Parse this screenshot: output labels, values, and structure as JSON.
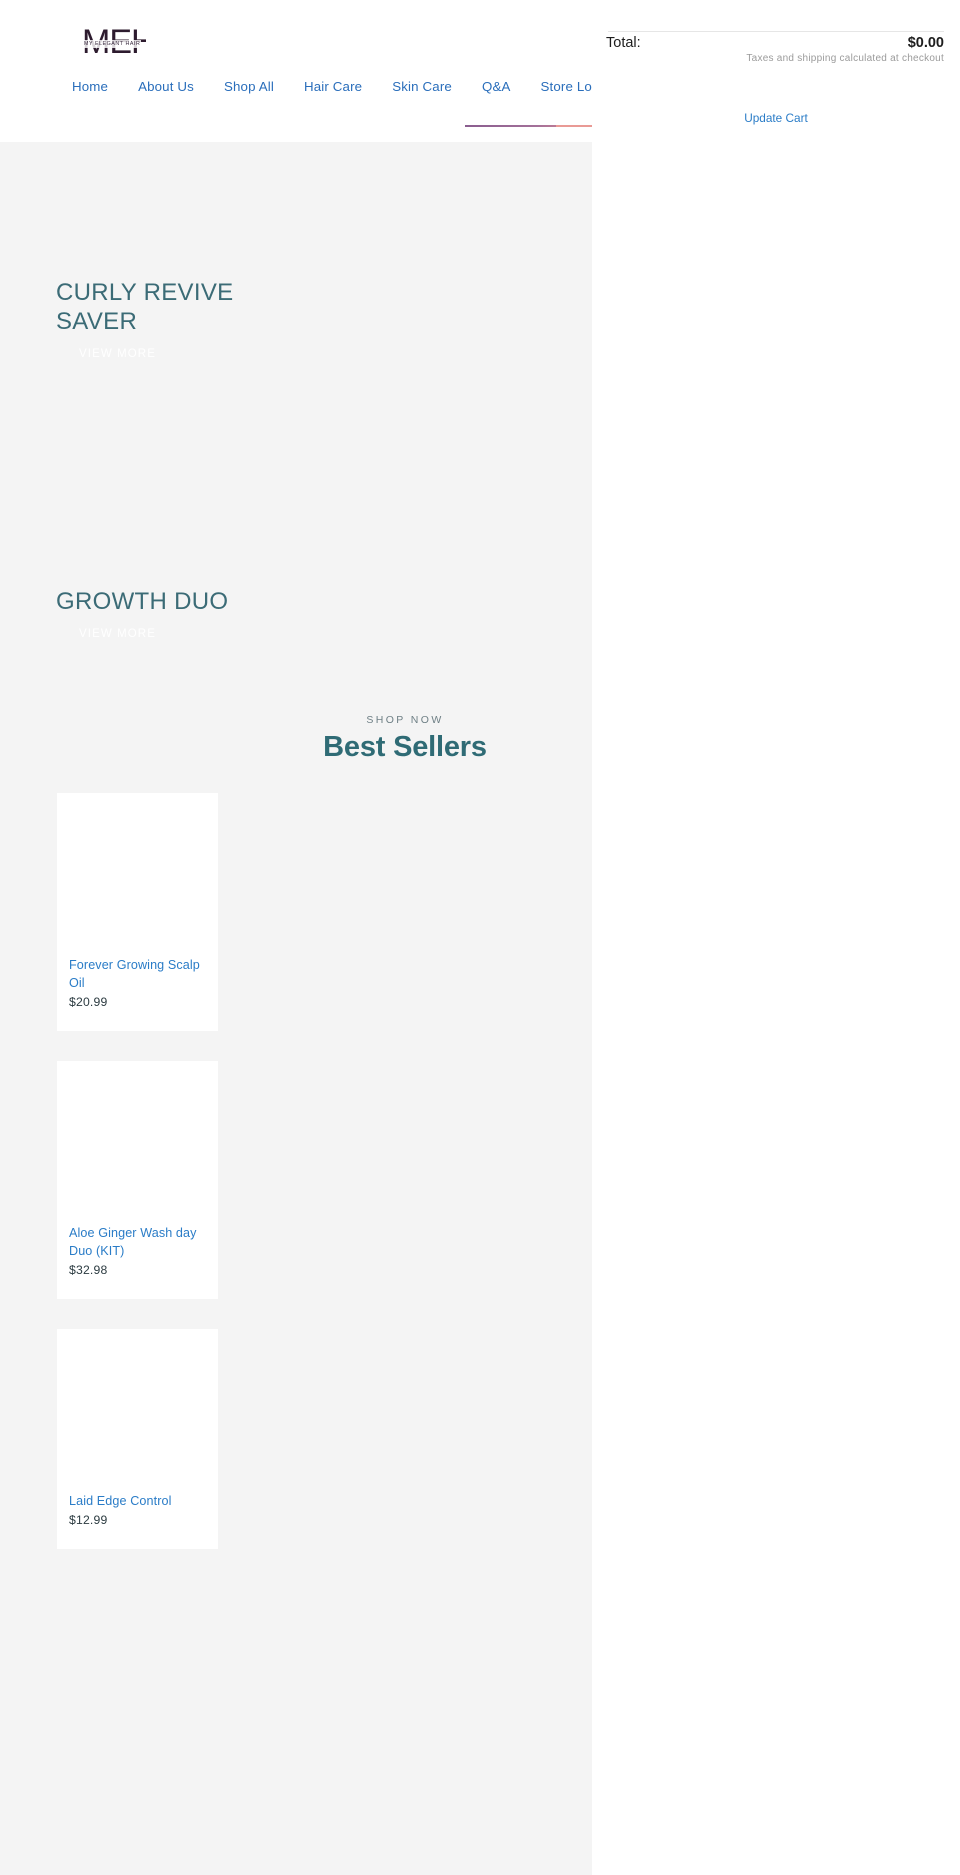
{
  "site": {
    "logo_mark": "MEH",
    "logo_tagline": "MY ELEGANT HAIR"
  },
  "nav": {
    "items": [
      {
        "label": "Home"
      },
      {
        "label": "About Us"
      },
      {
        "label": "Shop All"
      },
      {
        "label": "Hair Care"
      },
      {
        "label": "Skin Care"
      },
      {
        "label": "Q&A"
      },
      {
        "label": "Store Location"
      }
    ]
  },
  "heroes": [
    {
      "title": "CURLY REVIVE SAVER",
      "cta": "VIEW MORE"
    },
    {
      "title": "GROWTH DUO",
      "cta": "VIEW MORE"
    }
  ],
  "best_sellers": {
    "eyebrow": "SHOP NOW",
    "title": "Best Sellers",
    "products": [
      {
        "title": "Forever Growing Scalp Oil",
        "price": "$20.99"
      },
      {
        "title": "Aloe Ginger Wash day Duo (KIT)",
        "price": "$32.98"
      },
      {
        "title": "Laid Edge Control",
        "price": "$12.99"
      }
    ]
  },
  "cart": {
    "total_label": "Total:",
    "total_value": "$0.00",
    "note": "Taxes and shipping calculated at checkout",
    "update_label": "Update Cart"
  },
  "colors": {
    "nav_link": "#2a6ebb",
    "heading_teal": "#2f6b75",
    "hero_title": "#3b6b76",
    "product_link": "#2a7cc7",
    "page_bg": "#f4f4f4",
    "accent_line": "#8a5d8f"
  }
}
